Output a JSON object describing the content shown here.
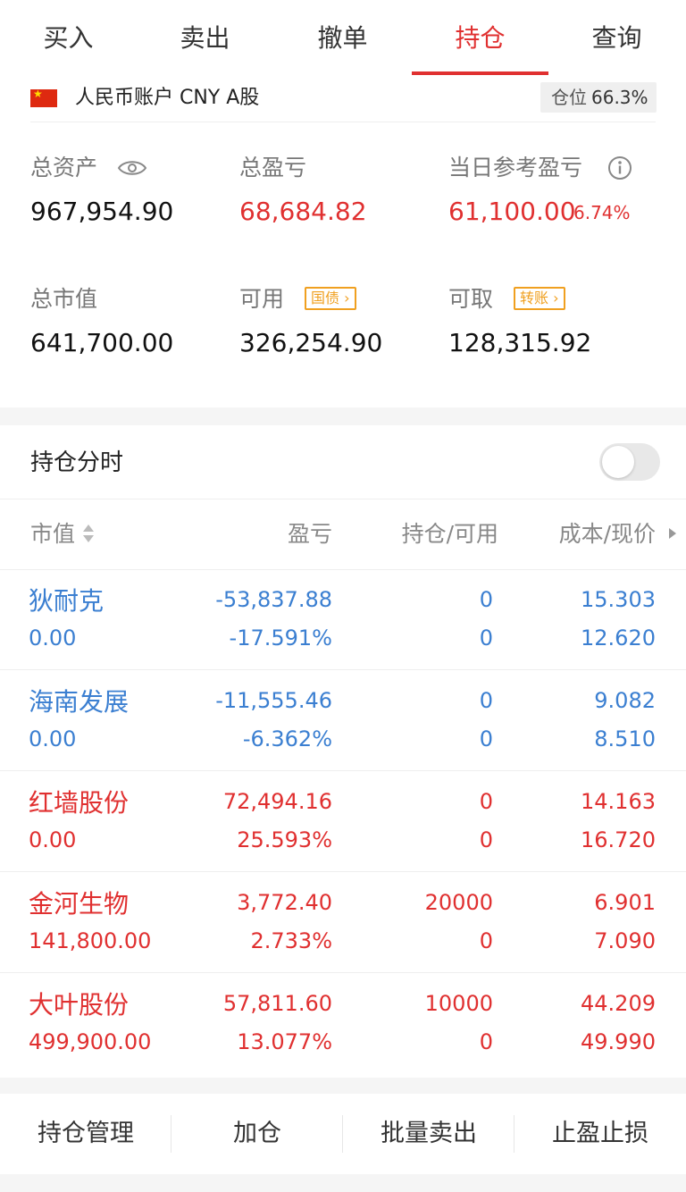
{
  "tabs": [
    {
      "label": "买入"
    },
    {
      "label": "卖出"
    },
    {
      "label": "撤单"
    },
    {
      "label": "持仓"
    },
    {
      "label": "查询"
    }
  ],
  "active_tab": "持仓",
  "account": {
    "name": "人民币账户 CNY A股",
    "position_label": "仓位",
    "position_value": "66.3%"
  },
  "metrics": {
    "total_assets_label": "总资产",
    "total_assets": "967,954.90",
    "total_pl_label": "总盈亏",
    "total_pl": "68,684.82",
    "daily_pl_label": "当日参考盈亏",
    "daily_pl": "61,100.00",
    "daily_pl_pct": "6.74%",
    "market_value_label": "总市值",
    "market_value": "641,700.00",
    "available_label": "可用",
    "available": "326,254.90",
    "available_tag": "国债",
    "withdrawable_label": "可取",
    "withdrawable": "128,315.92",
    "withdrawable_tag": "转账"
  },
  "holdings": {
    "title": "持仓分时",
    "toggle_on": false,
    "columns": [
      "市值",
      "盈亏",
      "持仓/可用",
      "成本/现价"
    ],
    "rows": [
      {
        "name": "狄耐克",
        "market_value": "0.00",
        "pl": "-53,837.88",
        "pl_pct": "-17.591%",
        "hold": "0",
        "avail": "0",
        "cost": "15.303",
        "price": "12.620",
        "color": "blue"
      },
      {
        "name": "海南发展",
        "market_value": "0.00",
        "pl": "-11,555.46",
        "pl_pct": "-6.362%",
        "hold": "0",
        "avail": "0",
        "cost": "9.082",
        "price": "8.510",
        "color": "blue"
      },
      {
        "name": "红墙股份",
        "market_value": "0.00",
        "pl": "72,494.16",
        "pl_pct": "25.593%",
        "hold": "0",
        "avail": "0",
        "cost": "14.163",
        "price": "16.720",
        "color": "red"
      },
      {
        "name": "金河生物",
        "market_value": "141,800.00",
        "pl": "3,772.40",
        "pl_pct": "2.733%",
        "hold": "20000",
        "avail": "0",
        "cost": "6.901",
        "price": "7.090",
        "color": "red"
      },
      {
        "name": "大叶股份",
        "market_value": "499,900.00",
        "pl": "57,811.60",
        "pl_pct": "13.077%",
        "hold": "10000",
        "avail": "0",
        "cost": "44.209",
        "price": "49.990",
        "color": "red"
      }
    ]
  },
  "bottom_actions": [
    {
      "label": "持仓管理"
    },
    {
      "label": "加仓"
    },
    {
      "label": "批量卖出"
    },
    {
      "label": "止盈止损"
    }
  ],
  "colors": {
    "accent_red": "#e03030",
    "loss_blue": "#3b7fd1",
    "tag_orange": "#f0a020"
  }
}
